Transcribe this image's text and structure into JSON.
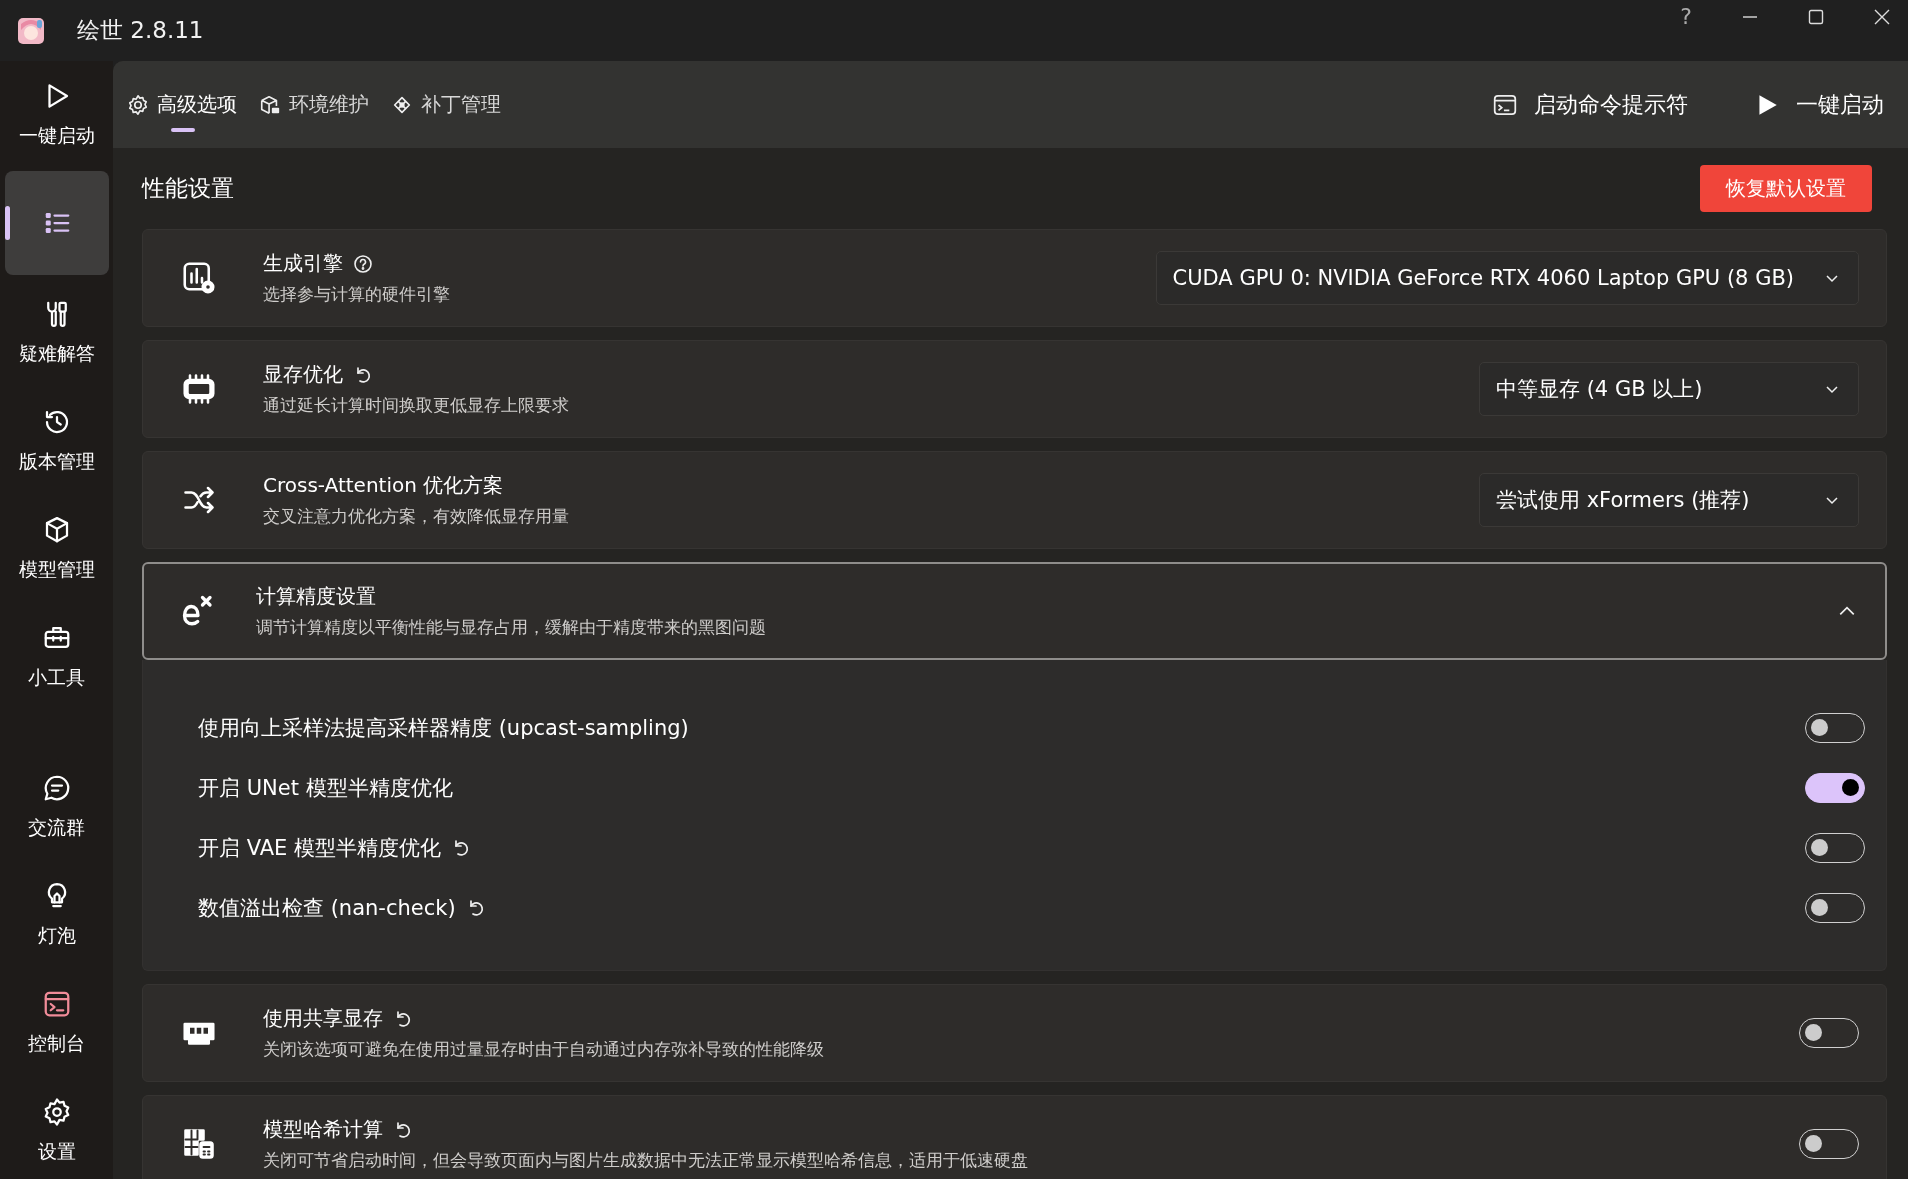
{
  "window": {
    "title": "绘世 2.8.11",
    "help": "?"
  },
  "sidebar": {
    "items": [
      {
        "label": "一键启动",
        "selected": false
      },
      {
        "selected": true
      },
      {
        "label": "疑难解答",
        "selected": false
      },
      {
        "label": "版本管理",
        "selected": false
      },
      {
        "label": "模型管理",
        "selected": false
      },
      {
        "label": "小工具",
        "selected": false
      }
    ],
    "bottom_items": [
      {
        "label": "交流群",
        "selected": false
      },
      {
        "label": "灯泡",
        "selected": false
      },
      {
        "label": "控制台",
        "selected": false
      },
      {
        "label": "设置",
        "selected": false
      }
    ]
  },
  "tabs": [
    {
      "label": "高级选项",
      "selected": true
    },
    {
      "label": "环境维护",
      "selected": false
    },
    {
      "label": "补丁管理",
      "selected": false
    }
  ],
  "actions": [
    {
      "label": "启动命令提示符"
    },
    {
      "label": "一键启动"
    }
  ],
  "section": {
    "title": "性能设置",
    "reset_button": "恢复默认设置"
  },
  "settings": [
    {
      "kind": "select",
      "title": "生成引擎",
      "help": true,
      "resettable": false,
      "description": "选择参与计算的硬件引擎",
      "value": "CUDA GPU 0: NVIDIA GeForce RTX 4060 Laptop GPU (8 GB)"
    },
    {
      "kind": "select",
      "title": "显存优化",
      "help": false,
      "resettable": true,
      "description": "通过延长计算时间换取更低显存上限要求",
      "value": "中等显存 (4 GB 以上)"
    },
    {
      "kind": "select",
      "title": "Cross-Attention 优化方案",
      "help": false,
      "resettable": false,
      "description": "交叉注意力优化方案，有效降低显存用量",
      "value": "尝试使用 xFormers (推荐)"
    },
    {
      "kind": "expander",
      "title": "计算精度设置",
      "description": "调节计算精度以平衡性能与显存占用，缓解由于精度带来的黑图问题",
      "expanded": true,
      "options": [
        {
          "label": "使用向上采样法提高采样器精度 (upcast-sampling)",
          "resettable": false,
          "on": false
        },
        {
          "label": "开启 UNet 模型半精度优化",
          "resettable": false,
          "on": true
        },
        {
          "label": "开启 VAE 模型半精度优化",
          "resettable": true,
          "on": false
        },
        {
          "label": "数值溢出检查 (nan-check)",
          "resettable": true,
          "on": false
        }
      ]
    },
    {
      "kind": "toggle",
      "title": "使用共享显存",
      "help": false,
      "resettable": true,
      "description": "关闭该选项可避免在使用过量显存时由于自动通过内存弥补导致的性能降级",
      "on": false
    },
    {
      "kind": "toggle",
      "title": "模型哈希计算",
      "help": false,
      "resettable": true,
      "description": "关闭可节省启动时间，但会导致页面内与图片生成数据中无法正常显示模型哈希信息，适用于低速硬盘",
      "on": false
    }
  ]
}
